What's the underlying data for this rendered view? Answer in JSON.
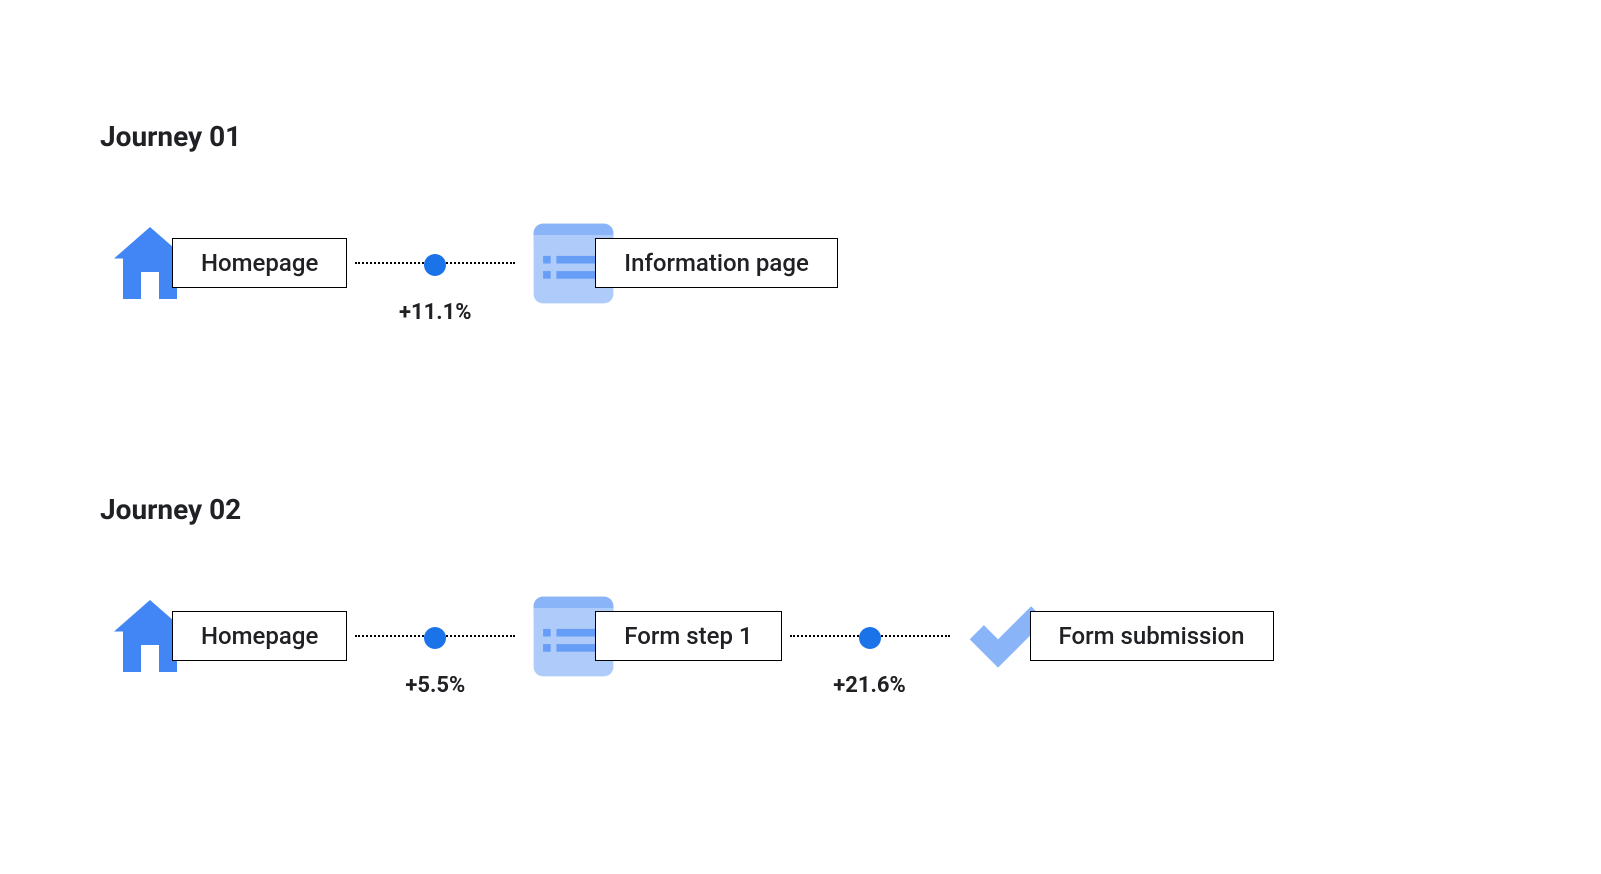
{
  "journeys": [
    {
      "title": "Journey 01",
      "steps": [
        {
          "icon": "home",
          "label": "Homepage"
        },
        {
          "icon": "list-page",
          "label": "Information page"
        }
      ],
      "connectors": [
        {
          "label": "+11.1%"
        }
      ]
    },
    {
      "title": "Journey 02",
      "steps": [
        {
          "icon": "home",
          "label": "Homepage"
        },
        {
          "icon": "list-page",
          "label": "Form step 1"
        },
        {
          "icon": "check",
          "label": "Form submission"
        }
      ],
      "connectors": [
        {
          "label": "+5.5%"
        },
        {
          "label": "+21.6%"
        }
      ]
    }
  ],
  "colors": {
    "primary": "#1a73e8",
    "light": "#aecbfa",
    "text": "#202124"
  }
}
